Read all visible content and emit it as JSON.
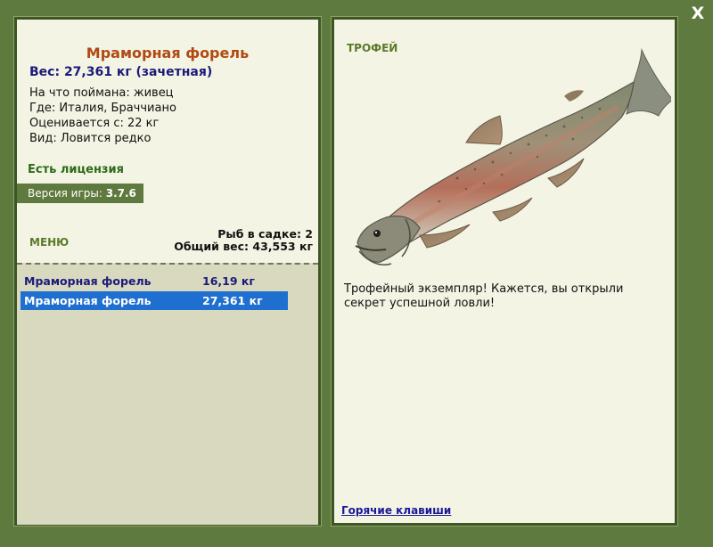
{
  "close_label": "X",
  "fish": {
    "name": "Мраморная форель",
    "weight_line": "Вес: 27,361 кг (зачетная)",
    "bait": "На что поймана: живец",
    "place": "Где: Италия, Браччиано",
    "min_weight": "Оценивается с: 22 кг",
    "view": "Вид: Ловится редко"
  },
  "license": "Есть лицензия",
  "version": {
    "label": "Версия игры:",
    "value": "3.7.6"
  },
  "menu_label": "МЕНЮ",
  "cage": {
    "count_text": "Рыб в садке: 2",
    "total_text": "Общий вес: 43,553 кг"
  },
  "catch_list": [
    {
      "name": "Мраморная форель",
      "weight": "16,19 кг"
    },
    {
      "name": "Мраморная форель",
      "weight": "27,361 кг"
    }
  ],
  "trophy": {
    "label": "ТРОФЕЙ",
    "description": "Трофейный экземпляр! Кажется, вы открыли секрет успешной ловли!"
  },
  "hotkeys_label": "Горячие клавиши",
  "colors": {
    "background": "#5f7a3e",
    "panel": "#f4f4e4",
    "title": "#b04a12",
    "selected_row": "#1e6fd0"
  }
}
